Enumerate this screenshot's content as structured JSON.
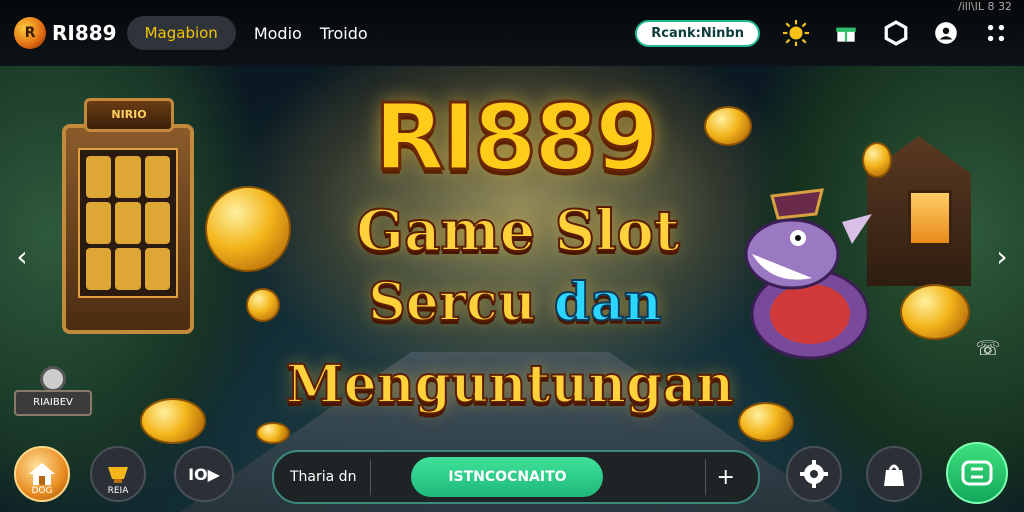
{
  "header": {
    "logo_text": "RI889",
    "nav_pill": "Magabion",
    "nav_links": [
      "Modio",
      "Troido"
    ],
    "rank_pill": "Rcank:Ninbn",
    "status_text": "/ill\\IL  8 32"
  },
  "hero": {
    "title": "RI889",
    "line1": "Game Slot",
    "line2_a": "Sercu",
    "line2_b": "dan",
    "line3": "Menguntungan",
    "slot_sign": "NIRIO",
    "side_badge_label": "RIAIBEV"
  },
  "bottom": {
    "home_label": "DOG",
    "rank_label": "REIA",
    "play_label": "IO▶",
    "search_label": "Tharia dn",
    "search_button": "ISTNCOCNAITO",
    "plus": "+"
  },
  "colors": {
    "accent_gold": "#ffcc1a",
    "accent_green": "#1fb97a",
    "accent_teal": "#2cd6ff"
  }
}
